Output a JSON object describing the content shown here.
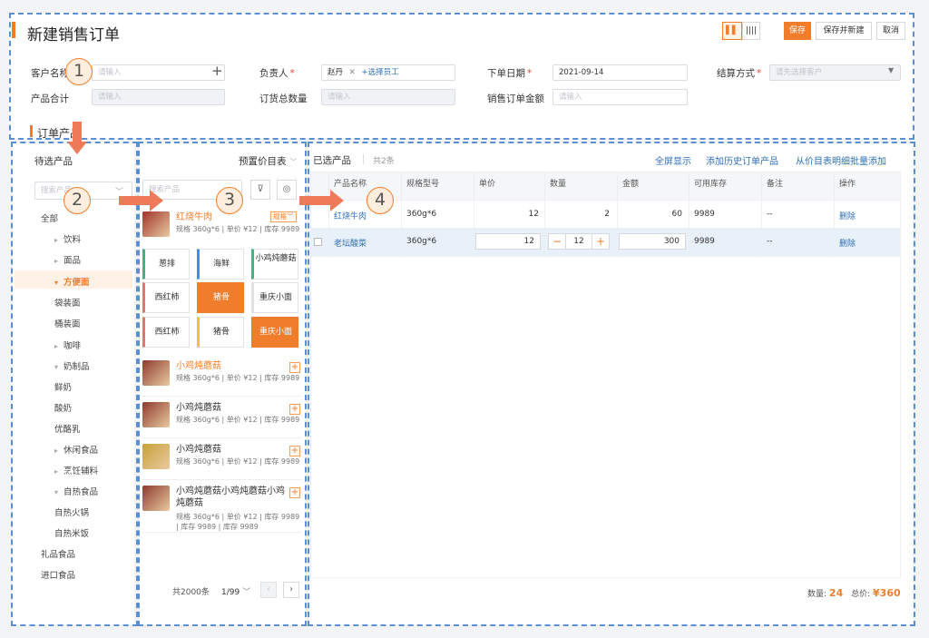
{
  "header": {
    "title": "新建销售订单",
    "save": "保存",
    "save_new": "保存并新建",
    "cancel": "取消"
  },
  "form": {
    "customer_label": "客户名称",
    "customer_placeholder": "请输入",
    "owner_label": "负责人",
    "owner_chip": "赵丹",
    "owner_add": "+选择员工",
    "date_label": "下单日期",
    "date_value": "2021-09-14",
    "settle_label": "结算方式",
    "settle_placeholder": "请先选择客户",
    "product_total_label": "产品合计",
    "product_total_placeholder": "请输入",
    "qty_total_label": "订货总数量",
    "qty_total_placeholder": "请输入",
    "amount_label": "销售订单金额",
    "amount_placeholder": "请输入"
  },
  "section_title": "订单产品",
  "left": {
    "title": "待选产品",
    "search_placeholder": "搜索产品",
    "tree": [
      "全部",
      "饮料",
      "面品",
      "方便面",
      "袋装面",
      "桶装面",
      "咖啡",
      "奶制品",
      "鲜奶",
      "酸奶",
      "优酪乳",
      "休闲食品",
      "烹饪辅料",
      "自热食品",
      "自热火锅",
      "自热米饭",
      "礼品食品",
      "进口食品"
    ]
  },
  "middle": {
    "pricebook": "预置价目表",
    "search_placeholder": "搜索产品",
    "spec_button": "规格",
    "tags": [
      "葱排",
      "海鲜",
      "小鸡炖蘑菇",
      "西红柿",
      "猪骨",
      "重庆小面",
      "西红柿",
      "猪骨",
      "重庆小面"
    ],
    "products": [
      {
        "name": "红烧牛肉",
        "meta": "规格 360g*6 | 单价 ¥12 | 库存 9989"
      },
      {
        "name": "小鸡炖蘑菇",
        "meta": "规格 360g*6 | 单价 ¥12 | 库存 9989"
      },
      {
        "name": "小鸡炖蘑菇",
        "meta": "规格 360g*6 | 单价 ¥12 | 库存 9989"
      },
      {
        "name": "小鸡炖蘑菇",
        "meta": "规格 360g*6 | 单价 ¥12 | 库存 9989"
      },
      {
        "name": "小鸡炖蘑菇小鸡炖蘑菇小鸡炖蘑菇",
        "meta": "规格 360g*6 | 单价 ¥12 | 库存 9989 | 库存 9989 | 库存 9989"
      }
    ],
    "total": "共2000条",
    "page": "1/99"
  },
  "right": {
    "title": "已选产品",
    "count": "共2条",
    "fullscreen": "全屏显示",
    "add_history": "添加历史订单产品",
    "add_pricebook": "从价目表明细批量添加",
    "columns": [
      "产品名称",
      "规格型号",
      "单价",
      "数量",
      "金额",
      "可用库存",
      "备注",
      "操作"
    ],
    "rows": [
      {
        "name": "红烧牛肉",
        "spec": "360g*6",
        "price": "12",
        "qty": "2",
        "amount": "60",
        "stock": "9989",
        "note": "--",
        "action": "删除"
      },
      {
        "name": "老坛酸菜",
        "spec": "360g*6",
        "price": "12",
        "qty": "12",
        "amount": "300",
        "stock": "9989",
        "note": "--",
        "action": "删除"
      }
    ],
    "qty_label": "数量:",
    "qty_value": "24",
    "total_label": "总价:",
    "total_value": "¥360"
  },
  "annotations": [
    "1",
    "2",
    "3",
    "4"
  ],
  "colors": {
    "accent": "#f07d2c",
    "link": "#2f6fb7",
    "dash": "#5b8fd1",
    "arrow": "#ef7a5a"
  }
}
